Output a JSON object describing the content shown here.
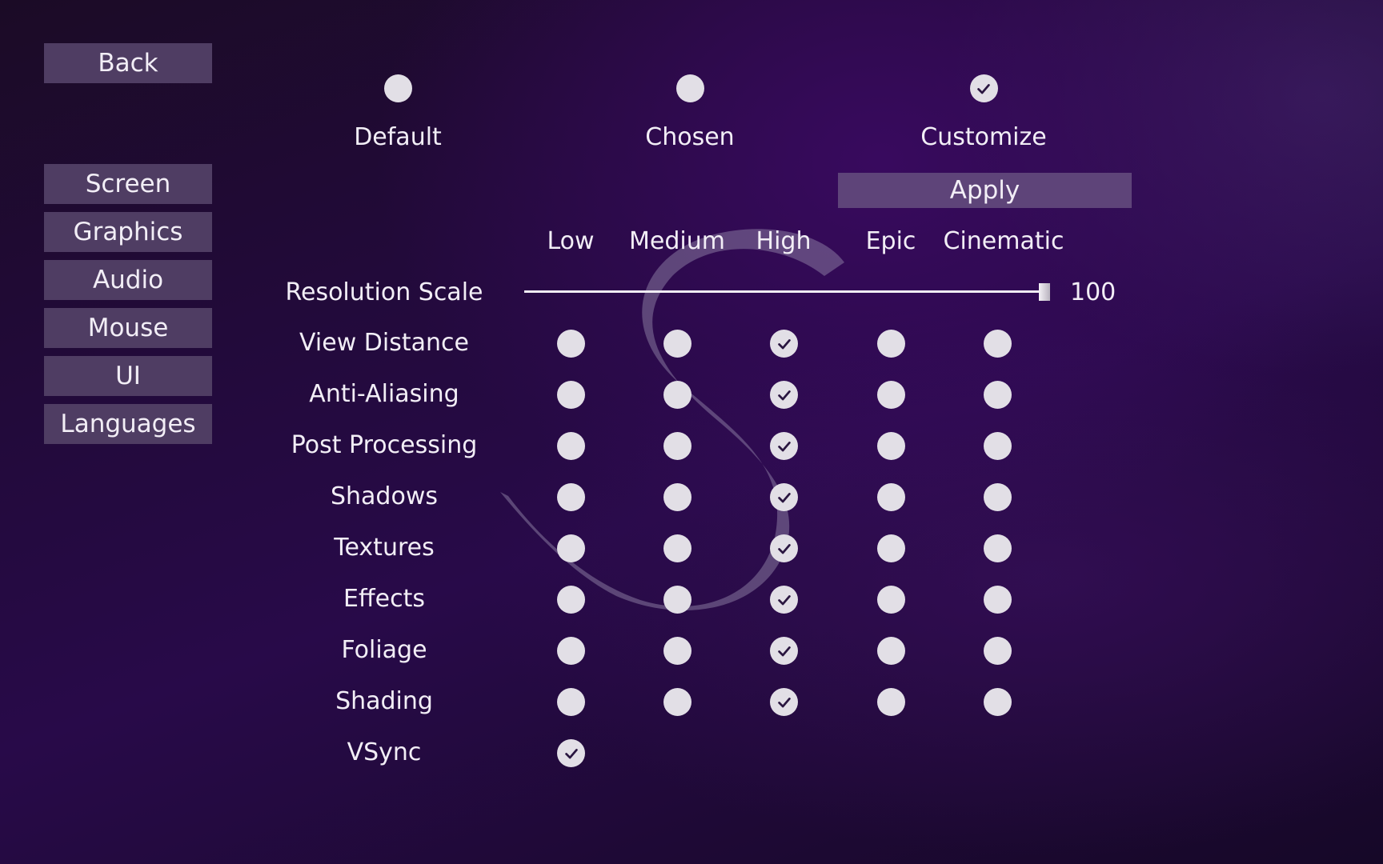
{
  "nav": {
    "back_label": "Back",
    "items": [
      "Screen",
      "Graphics",
      "Audio",
      "Mouse",
      "UI",
      "Languages"
    ]
  },
  "presets": {
    "options": [
      "Default",
      "Chosen",
      "Customize"
    ],
    "selected": "Customize",
    "apply_label": "Apply"
  },
  "quality_levels": [
    "Low",
    "Medium",
    "High",
    "Epic",
    "Cinematic"
  ],
  "resolution_scale": {
    "label": "Resolution Scale",
    "value": "100",
    "fraction": 1.0
  },
  "settings": [
    {
      "label": "View Distance",
      "selected": "High"
    },
    {
      "label": "Anti-Aliasing",
      "selected": "High"
    },
    {
      "label": "Post Processing",
      "selected": "High"
    },
    {
      "label": "Shadows",
      "selected": "High"
    },
    {
      "label": "Textures",
      "selected": "High"
    },
    {
      "label": "Effects",
      "selected": "High"
    },
    {
      "label": "Foliage",
      "selected": "High"
    },
    {
      "label": "Shading",
      "selected": "High"
    }
  ],
  "vsync": {
    "label": "VSync",
    "checked": true
  },
  "colors": {
    "background": "#230a3d",
    "button": "#4f3d63",
    "apply_button": "#5e4479",
    "radio": "#e2dfe6",
    "check": "#2a1640"
  },
  "icons": {
    "radio_checked": "check-icon",
    "watermark": "s-logo"
  }
}
